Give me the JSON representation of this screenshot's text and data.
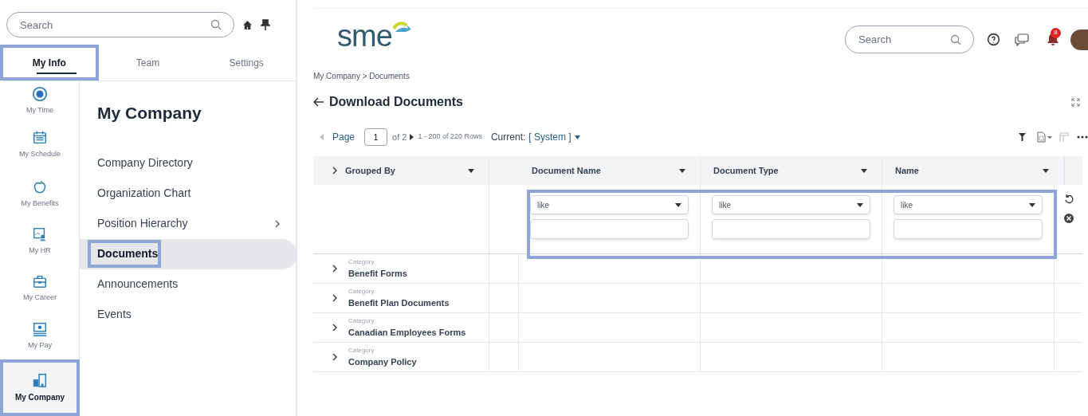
{
  "sidebar": {
    "search": {
      "placeholder": "Search"
    },
    "tabs": [
      {
        "label": "My Info",
        "selected": true,
        "highlighted": true
      },
      {
        "label": "Team",
        "selected": false,
        "highlighted": false
      },
      {
        "label": "Settings",
        "selected": false,
        "highlighted": false
      }
    ],
    "rail": [
      {
        "label": "My Time",
        "kind": "clock",
        "selected": false,
        "highlighted": false
      },
      {
        "label": "My Schedule",
        "kind": "calendar",
        "selected": false,
        "highlighted": false
      },
      {
        "label": "My Benefits",
        "kind": "apple",
        "selected": false,
        "highlighted": false
      },
      {
        "label": "My HR",
        "kind": "person",
        "selected": false,
        "highlighted": false
      },
      {
        "label": "My Career",
        "kind": "briefcase",
        "selected": false,
        "highlighted": false
      },
      {
        "label": "My Pay",
        "kind": "money",
        "selected": false,
        "highlighted": false
      },
      {
        "label": "My Company",
        "kind": "building",
        "selected": true,
        "highlighted": true
      }
    ],
    "menu_title": "My Company",
    "menu": [
      {
        "label": "Company Directory",
        "selected": false,
        "highlighted": false,
        "has_submenu": false
      },
      {
        "label": "Organization Chart",
        "selected": false,
        "highlighted": false,
        "has_submenu": false
      },
      {
        "label": "Position Hierarchy",
        "selected": false,
        "highlighted": false,
        "has_submenu": true
      },
      {
        "label": "Documents",
        "selected": true,
        "highlighted": true,
        "has_submenu": false
      },
      {
        "label": "Announcements",
        "selected": false,
        "highlighted": false,
        "has_submenu": false
      },
      {
        "label": "Events",
        "selected": false,
        "highlighted": false,
        "has_submenu": false
      }
    ]
  },
  "header": {
    "logo": "sme",
    "search": {
      "placeholder": "Search"
    },
    "notification_count": "8"
  },
  "breadcrumb": "My Company > Documents",
  "title": "Download Documents",
  "pager": {
    "page_label": "Page",
    "page": "1",
    "of": "of 2",
    "rows": "1 - 200 of 220 Rows",
    "view_label": "Current:",
    "view": "[ System ]"
  },
  "table": {
    "group_header": "Grouped By",
    "columns": [
      {
        "label": "Document Name"
      },
      {
        "label": "Document Type"
      },
      {
        "label": "Name"
      }
    ],
    "filters_highlighted": true,
    "filters": [
      {
        "operator": "like"
      },
      {
        "operator": "like"
      },
      {
        "operator": "like"
      }
    ],
    "rows": [
      {
        "label": "Category",
        "value": "Benefit Forms"
      },
      {
        "label": "Category",
        "value": "Benefit Plan Documents"
      },
      {
        "label": "Category",
        "value": "Canadian Employees Forms"
      },
      {
        "label": "Category",
        "value": "Company Policy"
      }
    ]
  }
}
